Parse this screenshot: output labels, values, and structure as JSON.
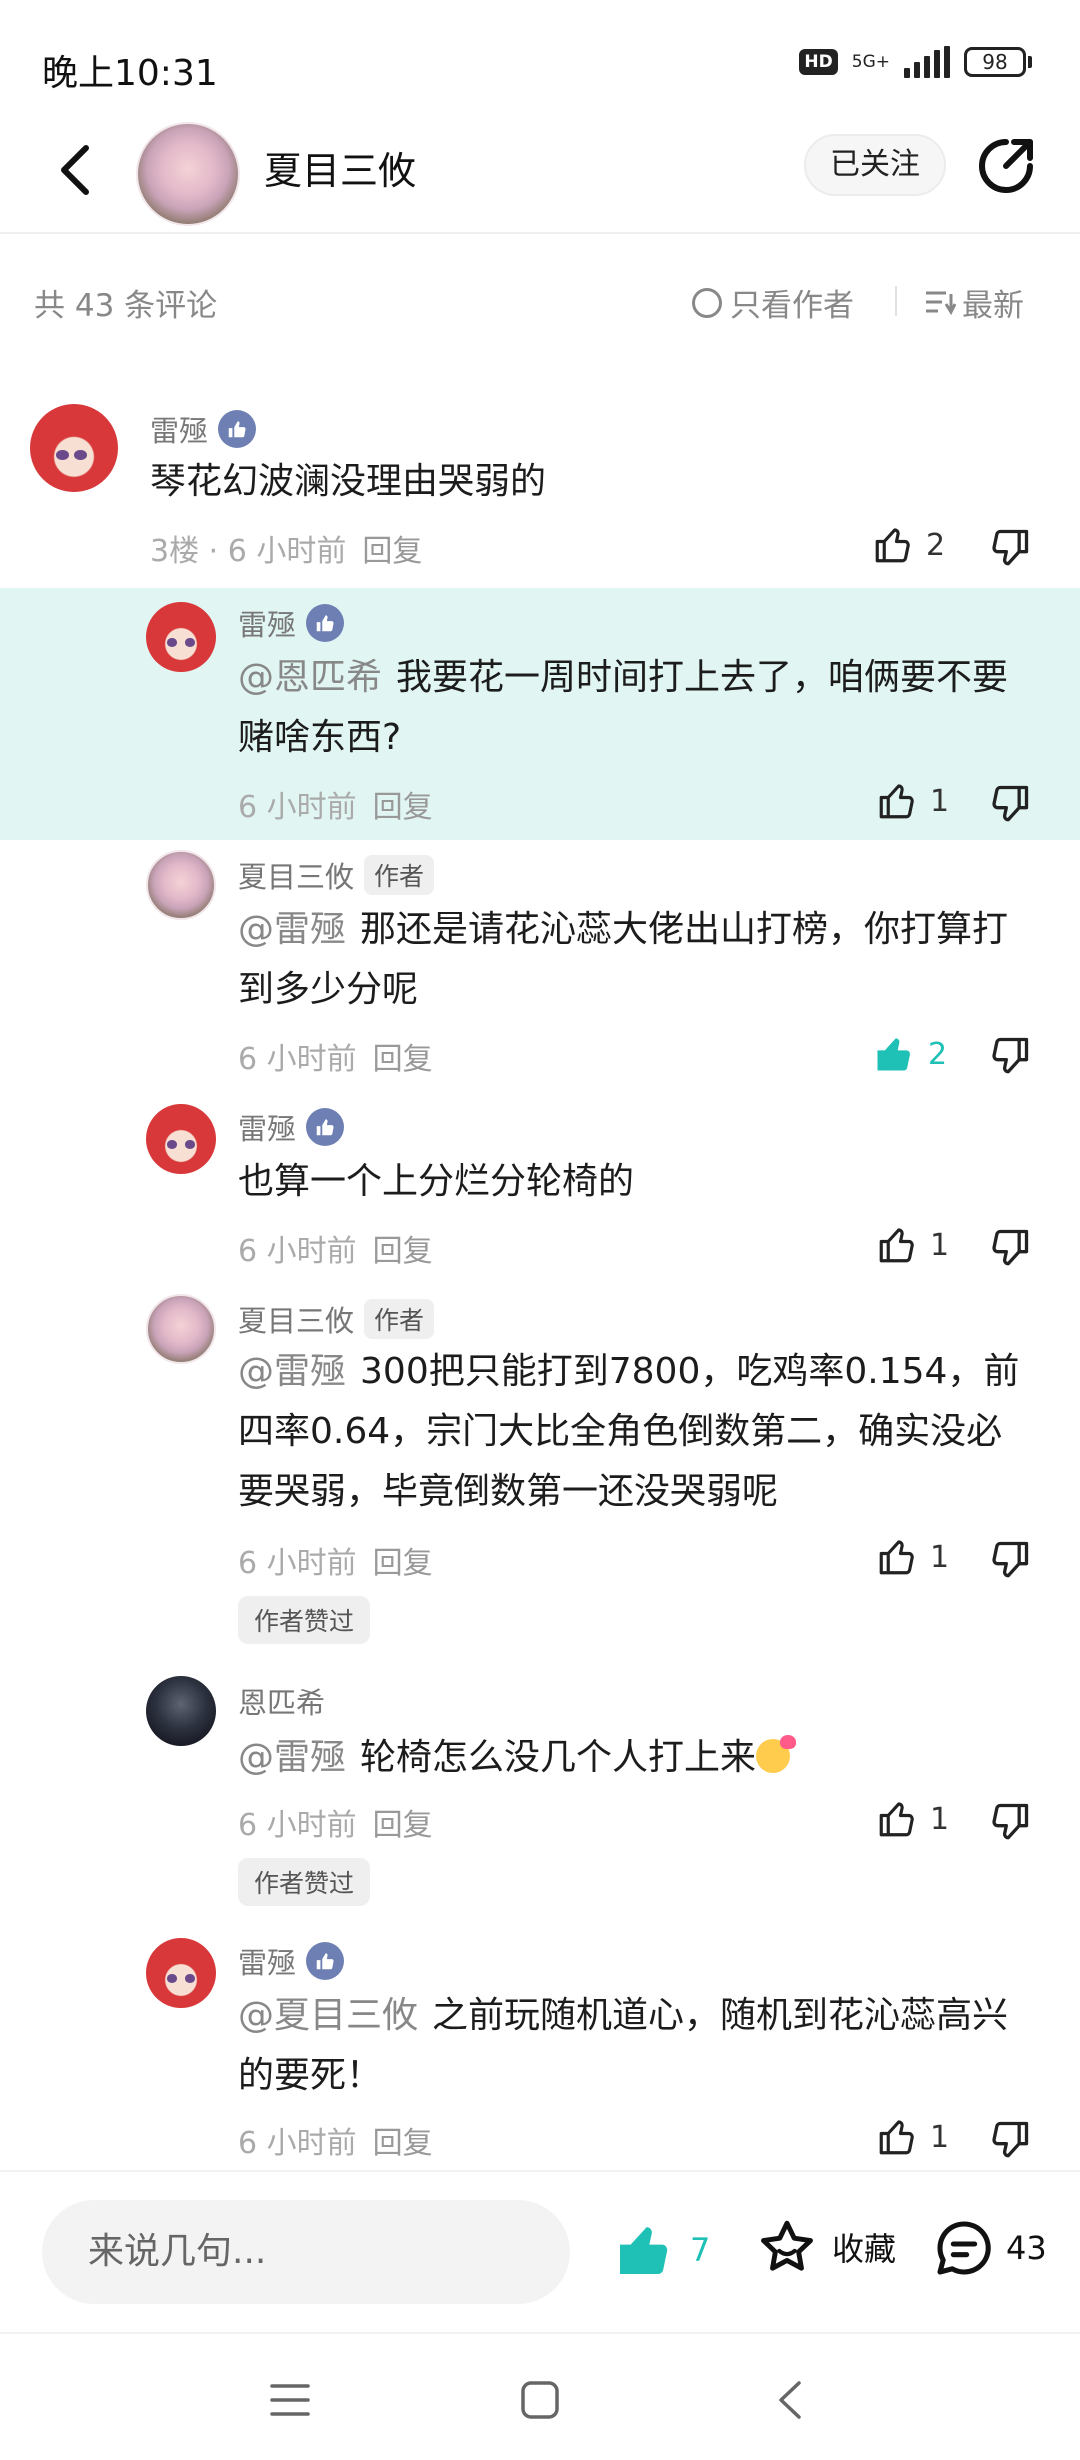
{
  "status_bar": {
    "time": "晚上10:31",
    "hd": "HD",
    "network": "5G+",
    "battery": "98"
  },
  "header": {
    "title": "夏目三攸",
    "follow_label": "已关注"
  },
  "sort_bar": {
    "count": "共 43 条评论",
    "only_author": "只看作者",
    "newest": "最新"
  },
  "comments": [
    {
      "user": "雷殛",
      "text": "琴花幻波澜没理由哭弱的",
      "floor": "3楼",
      "time": "6 小时前",
      "reply": "回复",
      "likes": "2"
    },
    {
      "user": "雷殛",
      "mention": "@恩匹希",
      "text": "我要花一周时间打上去了，咱俩要不要赌啥东西?",
      "time": "6 小时前",
      "reply": "回复",
      "likes": "1"
    },
    {
      "user": "夏目三攸",
      "badge": "作者",
      "mention": "@雷殛",
      "text": "那还是请花沁蕊大佬出山打榜，你打算打到多少分呢",
      "time": "6 小时前",
      "reply": "回复",
      "likes": "2"
    },
    {
      "user": "雷殛",
      "text": "也算一个上分烂分轮椅的",
      "time": "6 小时前",
      "reply": "回复",
      "likes": "1"
    },
    {
      "user": "夏目三攸",
      "badge": "作者",
      "mention": "@雷殛",
      "text": "300把只能打到7800，吃鸡率0.154，前四率0.64，宗门大比全角色倒数第二，确实没必要哭弱，毕竟倒数第一还没哭弱呢",
      "time": "6 小时前",
      "reply": "回复",
      "likes": "1",
      "author_liked": "作者赞过"
    },
    {
      "user": "恩匹希",
      "mention": "@雷殛",
      "text": "轮椅怎么没几个人打上来",
      "time": "6 小时前",
      "reply": "回复",
      "likes": "1",
      "author_liked": "作者赞过"
    },
    {
      "user": "雷殛",
      "mention": "@夏目三攸",
      "text": "之前玩随机道心，随机到花沁蕊高兴的要死！",
      "time": "6 小时前",
      "reply": "回复",
      "likes": "1"
    }
  ],
  "bottom_bar": {
    "input_placeholder": "来说几句...",
    "likes": "7",
    "favorite": "收藏",
    "comments": "43"
  },
  "colors": {
    "accent": "#1fc0b6",
    "highlight_bg": "#e1f6f3",
    "level_badge": "#6d7fb3"
  },
  "icons": [
    "back-arrow-icon",
    "share-icon",
    "thumbs-up-icon",
    "thumbs-down-icon",
    "star-icon",
    "comment-bubble-icon",
    "menu-icon",
    "home-square-icon",
    "nav-back-icon"
  ]
}
